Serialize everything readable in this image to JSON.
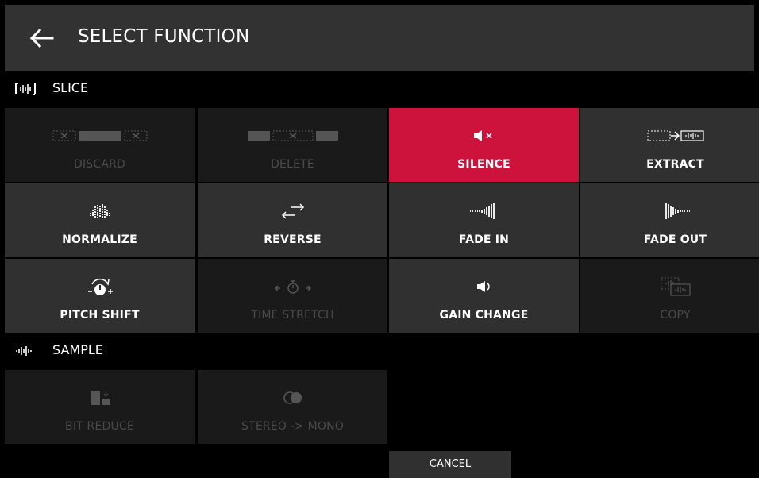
{
  "header": {
    "title": "SELECT FUNCTION",
    "back_icon": "arrow-left-icon"
  },
  "sections": {
    "slice": {
      "label": "SLICE",
      "icon": "slice-waveform-icon"
    },
    "sample": {
      "label": "SAMPLE",
      "icon": "sample-waveform-icon"
    }
  },
  "functions": {
    "discard": "DISCARD",
    "delete": "DELETE",
    "silence": "SILENCE",
    "extract": "EXTRACT",
    "normalize": "NORMALIZE",
    "reverse": "REVERSE",
    "fade_in": "FADE IN",
    "fade_out": "FADE OUT",
    "pitch_shift": "PITCH SHIFT",
    "time_stretch": "TIME STRETCH",
    "gain_change": "GAIN CHANGE",
    "copy": "COPY",
    "bit_reduce": "BIT REDUCE",
    "stereo_mono": "STEREO -> MONO"
  },
  "footer": {
    "cancel": "CANCEL"
  },
  "colors": {
    "accent": "#cd133c",
    "tile": "#303030",
    "tile_disabled": "#1a1a1a",
    "header": "#323232"
  }
}
